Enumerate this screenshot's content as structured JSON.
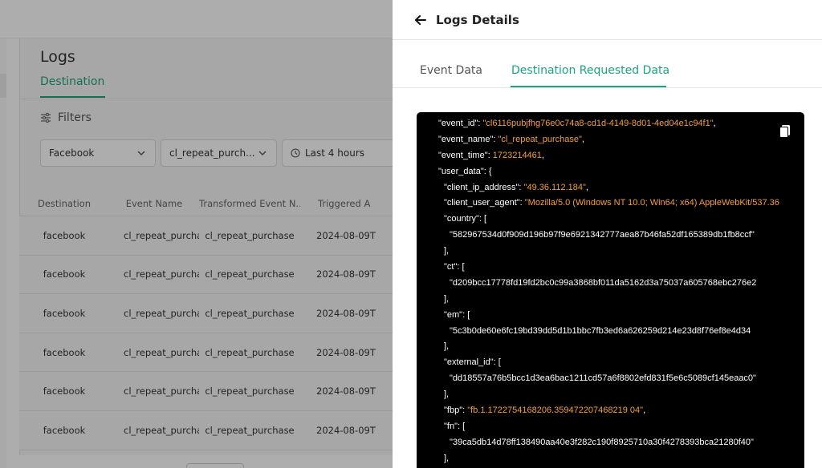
{
  "page": {
    "title": "Logs",
    "tab": "Destination",
    "filters_label": "Filters",
    "dropdowns": [
      "Facebook",
      "cl_repeat_purch...",
      "Last 4 hours"
    ]
  },
  "table": {
    "headers": [
      "Destination",
      "Event Name",
      "Transformed Event N...",
      "Triggered A"
    ],
    "rows": [
      {
        "destination": "facebook",
        "event_name": "cl_repeat_purchase",
        "transformed": "cl_repeat_purchase",
        "triggered": "2024-08-09T"
      },
      {
        "destination": "facebook",
        "event_name": "cl_repeat_purchase",
        "transformed": "cl_repeat_purchase",
        "triggered": "2024-08-09T"
      },
      {
        "destination": "facebook",
        "event_name": "cl_repeat_purchase",
        "transformed": "cl_repeat_purchase",
        "triggered": "2024-08-09T"
      },
      {
        "destination": "facebook",
        "event_name": "cl_repeat_purchase",
        "transformed": "cl_repeat_purchase",
        "triggered": "2024-08-09T"
      },
      {
        "destination": "facebook",
        "event_name": "cl_repeat_purchase",
        "transformed": "cl_repeat_purchase",
        "triggered": "2024-08-09T"
      },
      {
        "destination": "facebook",
        "event_name": "cl_repeat_purchase",
        "transformed": "cl_repeat_purchase",
        "triggered": "2024-08-09T"
      }
    ]
  },
  "drawer": {
    "title": "Logs Details",
    "tabs": [
      "Event Data",
      "Destination Requested Data"
    ],
    "active_tab": "Destination Requested Data"
  },
  "code_lines": [
    {
      "indent": 3,
      "parts": [
        {
          "t": "k",
          "v": "\"event_id\": "
        },
        {
          "t": "s",
          "v": "\"cl6116pubjfhg76e0c74a8-cd1d-4149-8d01-4ed04e1c94f1\""
        },
        {
          "t": "p",
          "v": ","
        }
      ]
    },
    {
      "indent": 3,
      "parts": [
        {
          "t": "k",
          "v": "\"event_name\": "
        },
        {
          "t": "s",
          "v": "\"cl_repeat_purchase\""
        },
        {
          "t": "p",
          "v": ","
        }
      ]
    },
    {
      "indent": 3,
      "parts": [
        {
          "t": "k",
          "v": "\"event_time\": "
        },
        {
          "t": "n",
          "v": "1723214461"
        },
        {
          "t": "p",
          "v": ","
        }
      ]
    },
    {
      "indent": 3,
      "parts": [
        {
          "t": "k",
          "v": "\"user_data\": {"
        }
      ]
    },
    {
      "indent": 4,
      "parts": [
        {
          "t": "k",
          "v": "\"client_ip_address\": "
        },
        {
          "t": "s",
          "v": "\"49.36.112.184\""
        },
        {
          "t": "p",
          "v": ","
        }
      ]
    },
    {
      "indent": 4,
      "parts": [
        {
          "t": "k",
          "v": "\"client_user_agent\": "
        },
        {
          "t": "s",
          "v": "\"Mozilla/5.0 (Windows NT 10.0; Win64; x64) AppleWebKit/537.36"
        }
      ]
    },
    {
      "indent": 4,
      "parts": [
        {
          "t": "k",
          "v": "\"country\": ["
        }
      ]
    },
    {
      "indent": 5,
      "parts": [
        {
          "t": "k",
          "v": "\"582967534d0f909d196b97f9e6921342777aea87b46fa52df165389db1fb8ccf\""
        }
      ]
    },
    {
      "indent": 4,
      "parts": [
        {
          "t": "p",
          "v": "],"
        }
      ]
    },
    {
      "indent": 4,
      "parts": [
        {
          "t": "k",
          "v": "\"ct\": ["
        }
      ]
    },
    {
      "indent": 5,
      "parts": [
        {
          "t": "k",
          "v": "\"d209bcc17778fd19fd2bc0c99a3868bf011da5162d3a75037a605768ebc276e2"
        }
      ]
    },
    {
      "indent": 4,
      "parts": [
        {
          "t": "p",
          "v": "],"
        }
      ]
    },
    {
      "indent": 4,
      "parts": [
        {
          "t": "k",
          "v": "\"em\": ["
        }
      ]
    },
    {
      "indent": 5,
      "parts": [
        {
          "t": "k",
          "v": "\"5c3b0de60e6fc19bd39dd5d1b1bbc7fb3ed6a626259d214e23d8f76ef8e4d34"
        }
      ]
    },
    {
      "indent": 4,
      "parts": [
        {
          "t": "p",
          "v": "],"
        }
      ]
    },
    {
      "indent": 4,
      "parts": [
        {
          "t": "k",
          "v": "\"external_id\": ["
        }
      ]
    },
    {
      "indent": 5,
      "parts": [
        {
          "t": "k",
          "v": "\"dd18557a76b5bcc1d3ea6bac1211cd57a6f8802efd831f5e6c5089cf145eaac0\""
        }
      ]
    },
    {
      "indent": 4,
      "parts": [
        {
          "t": "p",
          "v": "],"
        }
      ]
    },
    {
      "indent": 4,
      "parts": [
        {
          "t": "k",
          "v": "\"fbp\": "
        },
        {
          "t": "s",
          "v": "\"fb.1.1722754168206.359472207468219 04\""
        },
        {
          "t": "p",
          "v": ","
        }
      ]
    },
    {
      "indent": 4,
      "parts": [
        {
          "t": "k",
          "v": "\"fn\": ["
        }
      ]
    },
    {
      "indent": 5,
      "parts": [
        {
          "t": "k",
          "v": "\"39ca5db14d78ff138490aa40e3f282c190f8925710a30f4278393bca21280f40\""
        }
      ]
    },
    {
      "indent": 4,
      "parts": [
        {
          "t": "p",
          "v": "],"
        }
      ]
    }
  ],
  "colors": {
    "accent": "#1ea381",
    "code_bg": "#000000",
    "code_string": "#f59e3b",
    "code_key": "#ffffff"
  }
}
